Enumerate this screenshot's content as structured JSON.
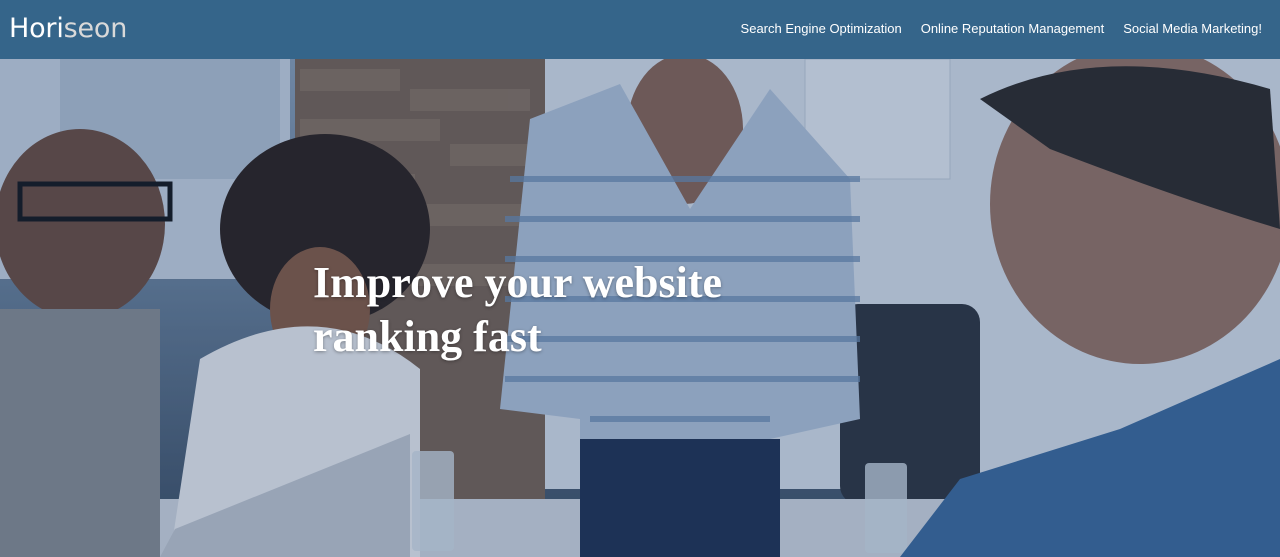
{
  "header": {
    "logo_main": "Hori",
    "logo_accent": "seon",
    "nav": [
      {
        "label": "Search Engine Optimization"
      },
      {
        "label": "Online Reputation Management"
      },
      {
        "label": "Social Media Marketing!"
      }
    ]
  },
  "hero": {
    "title": "Improve your website ranking fast"
  },
  "colors": {
    "header_bg": "#35658a",
    "text": "#ffffff"
  }
}
